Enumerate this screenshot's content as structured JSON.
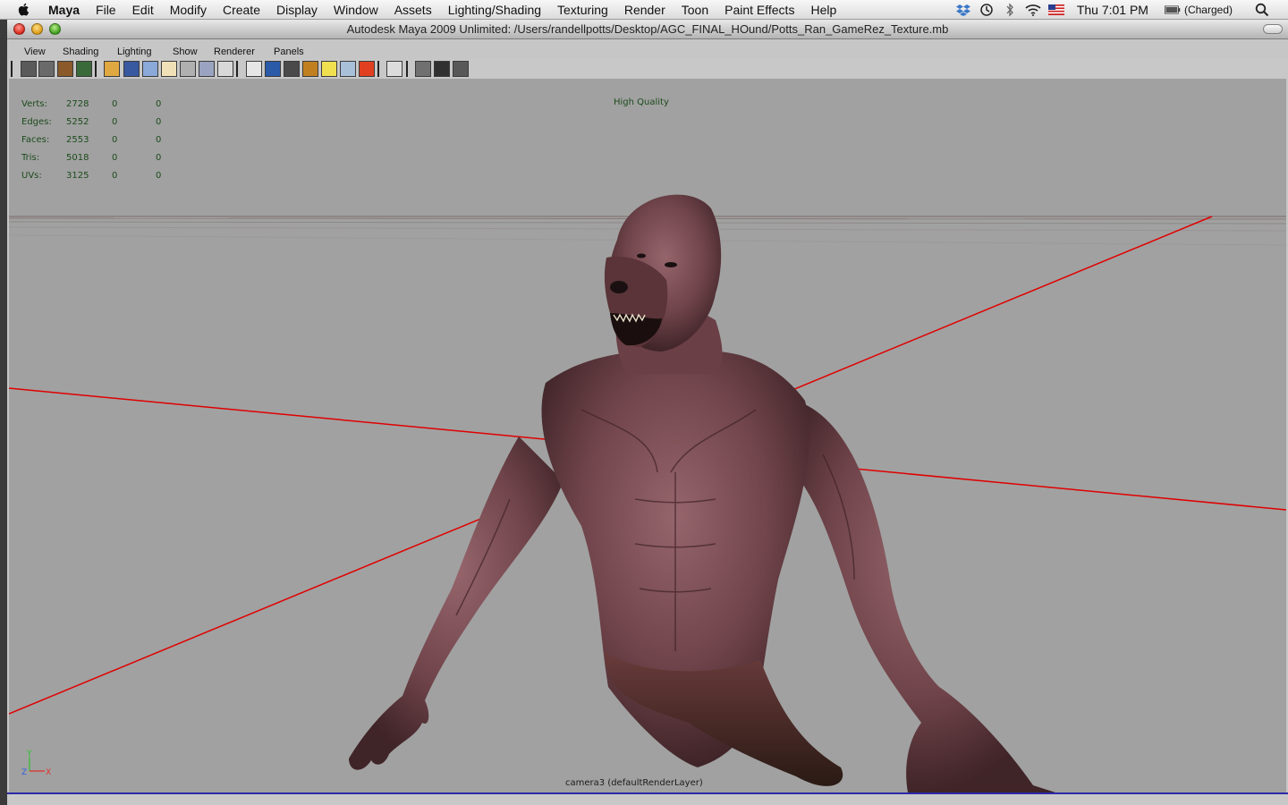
{
  "menubar": {
    "app": "Maya",
    "items": [
      "File",
      "Edit",
      "Modify",
      "Create",
      "Display",
      "Window",
      "Assets",
      "Lighting/Shading",
      "Texturing",
      "Render",
      "Toon",
      "Paint Effects",
      "Help"
    ],
    "clock": "Thu 7:01 PM",
    "battery": "(Charged)"
  },
  "window": {
    "title": "Autodesk Maya 2009 Unlimited: /Users/randellpotts/Desktop/AGC_FINAL_HOund/Potts_Ran_GameRez_Texture.mb"
  },
  "panel_menu": [
    "View",
    "Shading",
    "Lighting",
    "Show",
    "Renderer",
    "Panels"
  ],
  "hud": {
    "rows": [
      {
        "label": "Verts:",
        "total": "2728",
        "selected": "0",
        "uv": "0"
      },
      {
        "label": "Edges:",
        "total": "5252",
        "selected": "0",
        "uv": "0"
      },
      {
        "label": "Faces:",
        "total": "2553",
        "selected": "0",
        "uv": "0"
      },
      {
        "label": "Tris:",
        "total": "5018",
        "selected": "0",
        "uv": "0"
      },
      {
        "label": "UVs:",
        "total": "3125",
        "selected": "0",
        "uv": "0"
      }
    ],
    "quality": "High Quality",
    "camera": "camera3 (defaultRenderLayer)"
  },
  "axis": {
    "y": "Y",
    "z": "Z",
    "x": "X"
  },
  "colors": {
    "viewport_bg": "#a1a1a1",
    "grid_axis": "#e00000",
    "hud_text": "#1c4b1c",
    "skin": "#7a4f55"
  }
}
